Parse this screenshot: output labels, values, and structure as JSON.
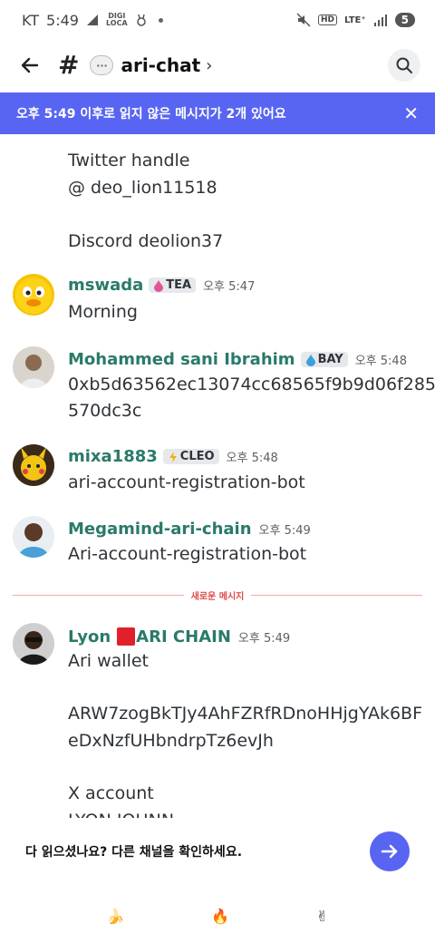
{
  "status_bar": {
    "carrier": "KT",
    "time": "5:49",
    "digi_line1": "DIGI",
    "digi_line2": "LOCA",
    "hd": "HD",
    "lte": "LTE⁺",
    "battery": "5"
  },
  "header": {
    "channel_icon_text": "···",
    "title": "ari-chat",
    "chevron": "›"
  },
  "banner": {
    "text": "오후 5:49 이후로 읽지 않은 메시지가 2개 있어요",
    "close": "✕"
  },
  "continued": {
    "lines": [
      "Twitter handle",
      "@ deo_lion11518",
      "",
      "Discord deolion37"
    ]
  },
  "messages": [
    {
      "username": "mswada",
      "tag": "TEA",
      "tag_icon": "drop-icon",
      "time": "오후 5:47",
      "lines": [
        "Morning"
      ]
    },
    {
      "username": "Mohammed sani Ibrahim",
      "tag": "BAY",
      "tag_icon": "drop-icon",
      "time": "오후 5:48",
      "lines": [
        "0xb5d63562ec13074cc68565f9b9d06f285",
        "570dc3c"
      ]
    },
    {
      "username": "mixa1883",
      "tag": "CLEO",
      "tag_icon": "lightning-icon",
      "time": "오후 5:48",
      "lines": [
        "ari-account-registration-bot"
      ]
    },
    {
      "username": "Megamind-ari-chain",
      "tag": "",
      "time": "오후 5:49",
      "lines": [
        "Ari-account-registration-bot"
      ]
    },
    {
      "username": "Lyon",
      "tag": "ARI CHAIN",
      "tag_icon": "red-square-icon",
      "time": "오후 5:49",
      "lines": [
        "Ari wallet",
        "",
        "ARW7zogBkTJy4AhFZRfRDnoHHjgYAk6BF",
        "eDxNzfUHbndrpTz6evJh",
        "",
        "X account",
        "LYON  JOHNN"
      ]
    }
  ],
  "divider": {
    "label": "새로운 메시지"
  },
  "footer": {
    "read_text": "다 읽으셨나요? 다른 채널을 확인하세요."
  },
  "reactions": [
    "🍌",
    "🔥",
    "✌"
  ],
  "colors": {
    "accent": "#5865f2",
    "username": "#2a7a6a",
    "new_divider": "#e04b4b"
  }
}
